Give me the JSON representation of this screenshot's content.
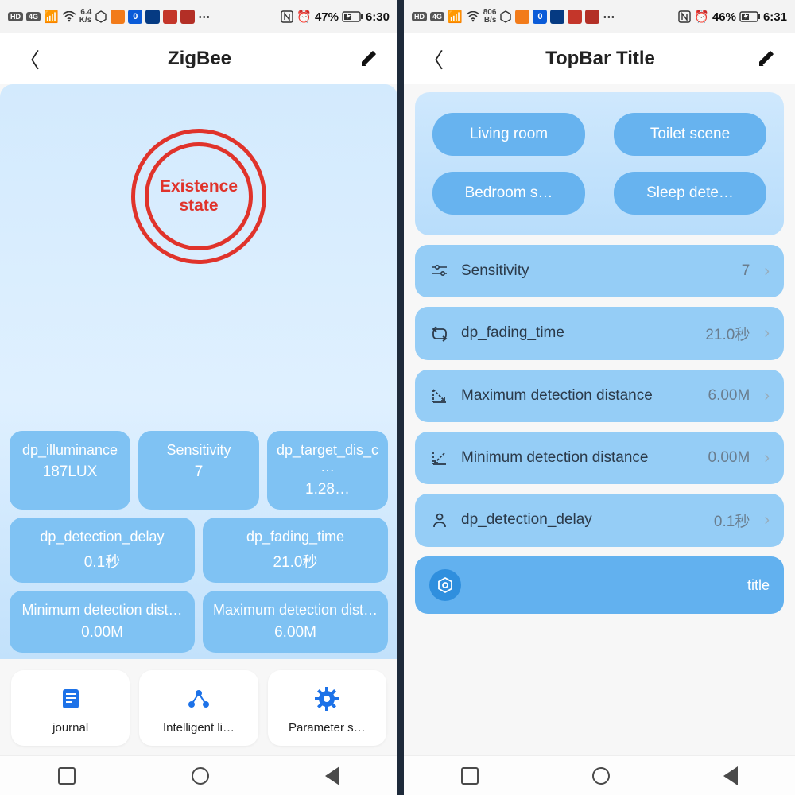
{
  "left": {
    "status": {
      "net_rate": "6.4",
      "net_unit": "K/s",
      "battery_text": "47%",
      "time": "6:30"
    },
    "header": {
      "title": "ZigBee"
    },
    "presence_label_l1": "Existence",
    "presence_label_l2": "state",
    "tiles_top": [
      {
        "label": "dp_illuminance",
        "value": "187LUX"
      },
      {
        "label": "Sensitivity",
        "value": "7"
      },
      {
        "label": "dp_target_dis_c…",
        "value": "1.28…"
      }
    ],
    "tiles_mid": [
      {
        "label": "dp_detection_delay",
        "value": "0.1秒"
      },
      {
        "label": "dp_fading_time",
        "value": "21.0秒"
      }
    ],
    "tiles_bot": [
      {
        "label": "Minimum detection dist…",
        "value": "0.00M"
      },
      {
        "label": "Maximum detection dist…",
        "value": "6.00M"
      }
    ],
    "actions": [
      {
        "label": "journal"
      },
      {
        "label": "Intelligent li…"
      },
      {
        "label": "Parameter s…"
      }
    ]
  },
  "right": {
    "status": {
      "net_rate": "806",
      "net_unit": "B/s",
      "battery_text": "46%",
      "time": "6:31"
    },
    "header": {
      "title": "TopBar Title"
    },
    "scenes": [
      "Living room",
      "Toilet scene",
      "Bedroom s…",
      "Sleep dete…"
    ],
    "settings": [
      {
        "label": "Sensitivity",
        "value": "7"
      },
      {
        "label": "dp_fading_time",
        "value": "21.0秒"
      },
      {
        "label": "Maximum detection distance",
        "value": "6.00M"
      },
      {
        "label": "Minimum detection distance",
        "value": "0.00M"
      },
      {
        "label": "dp_detection_delay",
        "value": "0.1秒"
      }
    ],
    "extra_label": "title"
  },
  "status_icons": {
    "hd": "HD",
    "fourg": "4G"
  }
}
